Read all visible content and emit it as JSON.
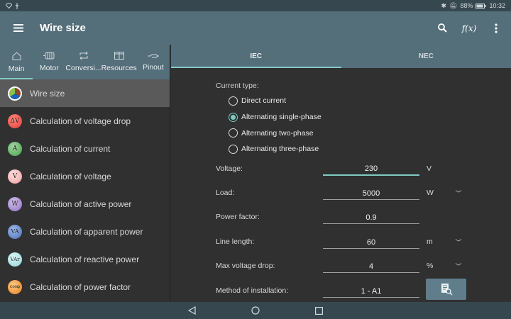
{
  "status": {
    "battery": "88%",
    "time": "10:32",
    "icons": [
      "wifi-icon",
      "usb-icon",
      "bluetooth-icon",
      "mute-icon",
      "battery-icon"
    ]
  },
  "appbar": {
    "title": "Wire size",
    "icons": [
      "menu-icon",
      "search-icon",
      "function-icon",
      "more-icon"
    ],
    "function_label": "f(x)"
  },
  "left_tabs": [
    {
      "label": "Main",
      "icon": "home-icon"
    },
    {
      "label": "Motor",
      "icon": "motor-icon"
    },
    {
      "label": "Conversi...",
      "icon": "conversion-icon"
    },
    {
      "label": "Resources",
      "icon": "book-icon"
    },
    {
      "label": "Pinout",
      "icon": "connector-icon"
    }
  ],
  "items": [
    {
      "label": "Wire size",
      "symbol": ""
    },
    {
      "label": "Calculation of voltage drop",
      "symbol": "ΔV",
      "color": "#e53935"
    },
    {
      "label": "Calculation of current",
      "symbol": "A",
      "color": "#4caf50"
    },
    {
      "label": "Calculation of voltage",
      "symbol": "V",
      "color": "#ef9a9a"
    },
    {
      "label": "Calculation of active power",
      "symbol": "W",
      "color": "#9575cd"
    },
    {
      "label": "Calculation of apparent power",
      "symbol": "VA",
      "color": "#5c7fc0"
    },
    {
      "label": "Calculation of reactive power",
      "symbol": "VAr",
      "color": "#a5dfe0"
    },
    {
      "label": "Calculation of power factor",
      "symbol": "cosφ",
      "color": "#ef8a3a"
    }
  ],
  "std_tabs": [
    "IEC",
    "NEC"
  ],
  "form": {
    "current_type_label": "Current type:",
    "current_types": [
      "Direct current",
      "Alternating single-phase",
      "Alternating two-phase",
      "Alternating three-phase"
    ],
    "selected_current_type": "Alternating single-phase",
    "voltage": {
      "label": "Voltage:",
      "value": "230",
      "unit": "V"
    },
    "load": {
      "label": "Load:",
      "value": "5000",
      "unit": "W"
    },
    "power_factor": {
      "label": "Power factor:",
      "value": "0.9"
    },
    "line_length": {
      "label": "Line length:",
      "value": "60",
      "unit": "m"
    },
    "max_drop": {
      "label": "Max voltage drop:",
      "value": "4",
      "unit": "%"
    },
    "installation": {
      "label": "Method of installation:",
      "value": "1 - A1"
    }
  },
  "colors": {
    "accent": "#80cbc4",
    "appbar": "#546e7a",
    "status": "#37474f"
  }
}
